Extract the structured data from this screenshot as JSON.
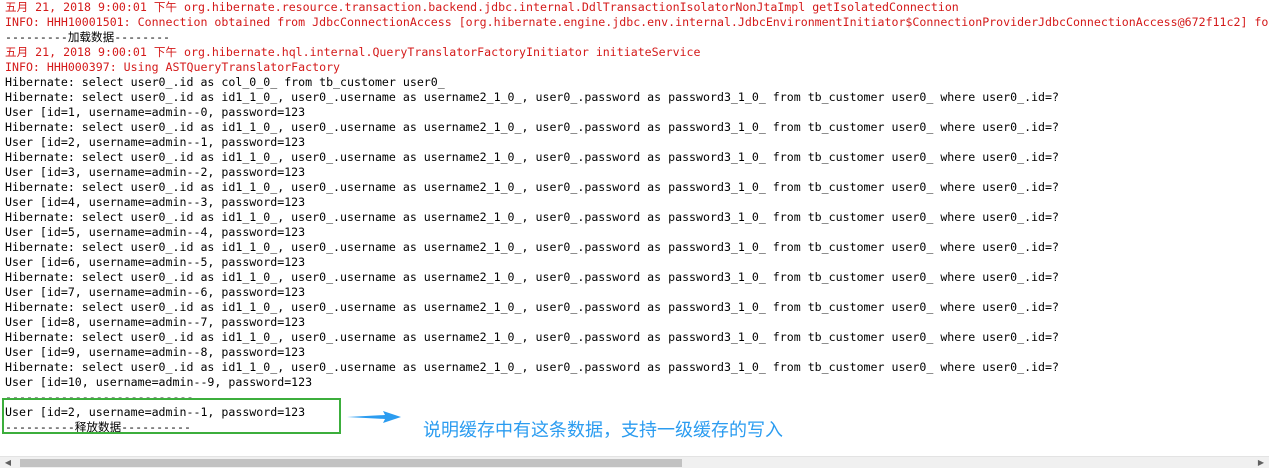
{
  "console": {
    "lines": [
      {
        "text": "五月 21, 2018 9:00:01 下午 org.hibernate.resource.transaction.backend.jdbc.internal.DdlTransactionIsolatorNonJtaImpl getIsolatedConnection",
        "color": "#d41a1a"
      },
      {
        "text": "INFO: HHH10001501: Connection obtained from JdbcConnectionAccess [org.hibernate.engine.jdbc.env.internal.JdbcEnvironmentInitiator$ConnectionProviderJdbcConnectionAccess@672f11c2] fo",
        "color": "#d41a1a"
      },
      {
        "text": "---------加载数据--------",
        "color": "#000000"
      },
      {
        "text": "五月 21, 2018 9:00:01 下午 org.hibernate.hql.internal.QueryTranslatorFactoryInitiator initiateService",
        "color": "#d41a1a"
      },
      {
        "text": "INFO: HHH000397: Using ASTQueryTranslatorFactory",
        "color": "#d41a1a"
      },
      {
        "text": "Hibernate: select user0_.id as col_0_0_ from tb_customer user0_",
        "color": "#000000"
      },
      {
        "text": "Hibernate: select user0_.id as id1_1_0_, user0_.username as username2_1_0_, user0_.password as password3_1_0_ from tb_customer user0_ where user0_.id=?",
        "color": "#000000"
      },
      {
        "text": "User [id=1, username=admin--0, password=123",
        "color": "#000000"
      },
      {
        "text": "Hibernate: select user0_.id as id1_1_0_, user0_.username as username2_1_0_, user0_.password as password3_1_0_ from tb_customer user0_ where user0_.id=?",
        "color": "#000000"
      },
      {
        "text": "User [id=2, username=admin--1, password=123",
        "color": "#000000"
      },
      {
        "text": "Hibernate: select user0_.id as id1_1_0_, user0_.username as username2_1_0_, user0_.password as password3_1_0_ from tb_customer user0_ where user0_.id=?",
        "color": "#000000"
      },
      {
        "text": "User [id=3, username=admin--2, password=123",
        "color": "#000000"
      },
      {
        "text": "Hibernate: select user0_.id as id1_1_0_, user0_.username as username2_1_0_, user0_.password as password3_1_0_ from tb_customer user0_ where user0_.id=?",
        "color": "#000000"
      },
      {
        "text": "User [id=4, username=admin--3, password=123",
        "color": "#000000"
      },
      {
        "text": "Hibernate: select user0_.id as id1_1_0_, user0_.username as username2_1_0_, user0_.password as password3_1_0_ from tb_customer user0_ where user0_.id=?",
        "color": "#000000"
      },
      {
        "text": "User [id=5, username=admin--4, password=123",
        "color": "#000000"
      },
      {
        "text": "Hibernate: select user0_.id as id1_1_0_, user0_.username as username2_1_0_, user0_.password as password3_1_0_ from tb_customer user0_ where user0_.id=?",
        "color": "#000000"
      },
      {
        "text": "User [id=6, username=admin--5, password=123",
        "color": "#000000"
      },
      {
        "text": "Hibernate: select user0_.id as id1_1_0_, user0_.username as username2_1_0_, user0_.password as password3_1_0_ from tb_customer user0_ where user0_.id=?",
        "color": "#000000"
      },
      {
        "text": "User [id=7, username=admin--6, password=123",
        "color": "#000000"
      },
      {
        "text": "Hibernate: select user0_.id as id1_1_0_, user0_.username as username2_1_0_, user0_.password as password3_1_0_ from tb_customer user0_ where user0_.id=?",
        "color": "#000000"
      },
      {
        "text": "User [id=8, username=admin--7, password=123",
        "color": "#000000"
      },
      {
        "text": "Hibernate: select user0_.id as id1_1_0_, user0_.username as username2_1_0_, user0_.password as password3_1_0_ from tb_customer user0_ where user0_.id=?",
        "color": "#000000"
      },
      {
        "text": "User [id=9, username=admin--8, password=123",
        "color": "#000000"
      },
      {
        "text": "Hibernate: select user0_.id as id1_1_0_, user0_.username as username2_1_0_, user0_.password as password3_1_0_ from tb_customer user0_ where user0_.id=?",
        "color": "#000000"
      },
      {
        "text": "User [id=10, username=admin--9, password=123",
        "color": "#000000"
      },
      {
        "text": "---------------------------",
        "color": "#000000"
      },
      {
        "text": "User [id=2, username=admin--1, password=123",
        "color": "#000000"
      },
      {
        "text": "----------释放数据----------",
        "color": "#000000"
      }
    ]
  },
  "annotation": {
    "text": "说明缓存中有这条数据，支持一级缓存的写入",
    "text_color": "#2b9cf0",
    "box_color": "#3cae3c",
    "arrow_color": "#2b9cf0"
  },
  "scrollbar": {
    "left_icon": "scroll-left-arrow-icon",
    "right_icon": "scroll-right-arrow-icon",
    "left_glyph": "◀",
    "right_glyph": "▶"
  }
}
